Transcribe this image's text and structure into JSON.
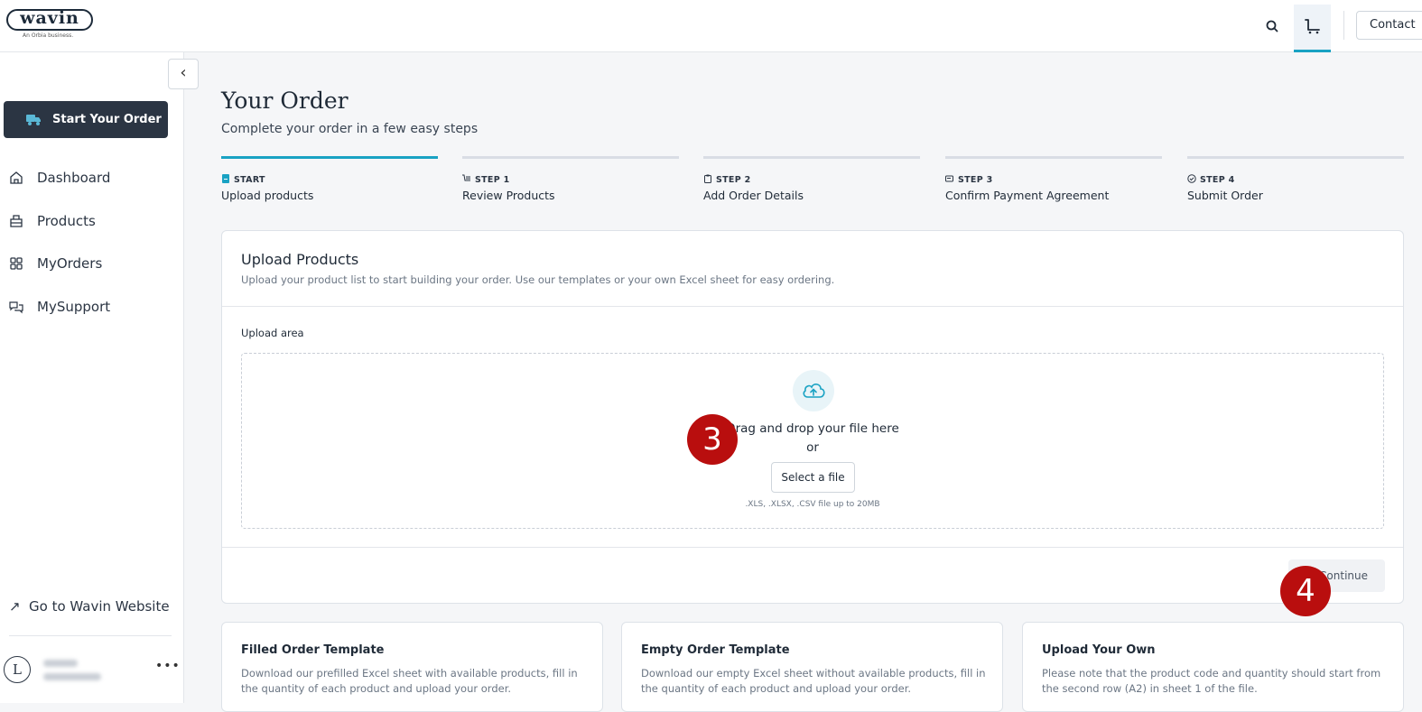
{
  "brand": {
    "logo_text": "wavin",
    "tagline": "An Orbia business."
  },
  "topbar": {
    "contact_label": "Contact"
  },
  "sidebar": {
    "start_order_label": "Start Your Order",
    "items": [
      {
        "label": "Dashboard",
        "icon": "home-icon"
      },
      {
        "label": "Products",
        "icon": "products-icon"
      },
      {
        "label": "MyOrders",
        "icon": "grid-icon"
      },
      {
        "label": "MySupport",
        "icon": "chat-icon"
      }
    ],
    "go_wavin_label": "Go to Wavin Website",
    "user_initial": "L"
  },
  "page": {
    "title": "Your Order",
    "subtitle": "Complete your order in a few easy steps"
  },
  "steps": [
    {
      "kicker": "START",
      "name": "Upload products",
      "active": true
    },
    {
      "kicker": "STEP 1",
      "name": "Review Products",
      "active": false
    },
    {
      "kicker": "STEP 2",
      "name": "Add Order Details",
      "active": false
    },
    {
      "kicker": "STEP 3",
      "name": "Confirm Payment Agreement",
      "active": false
    },
    {
      "kicker": "STEP 4",
      "name": "Submit Order",
      "active": false
    }
  ],
  "upload": {
    "title": "Upload Products",
    "description": "Upload your product list to start building your order. Use our templates or your own Excel sheet for easy ordering.",
    "area_label": "Upload area",
    "drag_text": "Drag and drop your file here",
    "or_text": "or",
    "select_label": "Select a file",
    "hint": ".XLS, .XLSX, .CSV file up to 20MB",
    "continue_label": "Continue"
  },
  "templates": [
    {
      "title": "Filled Order Template",
      "desc": "Download our prefilled Excel sheet with available products, fill in the quantity of each product and upload your order."
    },
    {
      "title": "Empty Order Template",
      "desc": "Download our empty Excel sheet without available products, fill in the quantity of each product and upload your order."
    },
    {
      "title": "Upload Your Own",
      "desc": "Please note that the product code and quantity should start from the second row (A2) in sheet 1 of the file."
    }
  ],
  "badges": {
    "first": "3",
    "second": "4"
  },
  "colors": {
    "accent": "#19a2c3",
    "sidebar_button": "#2b3543",
    "badge": "#b90e0e"
  }
}
